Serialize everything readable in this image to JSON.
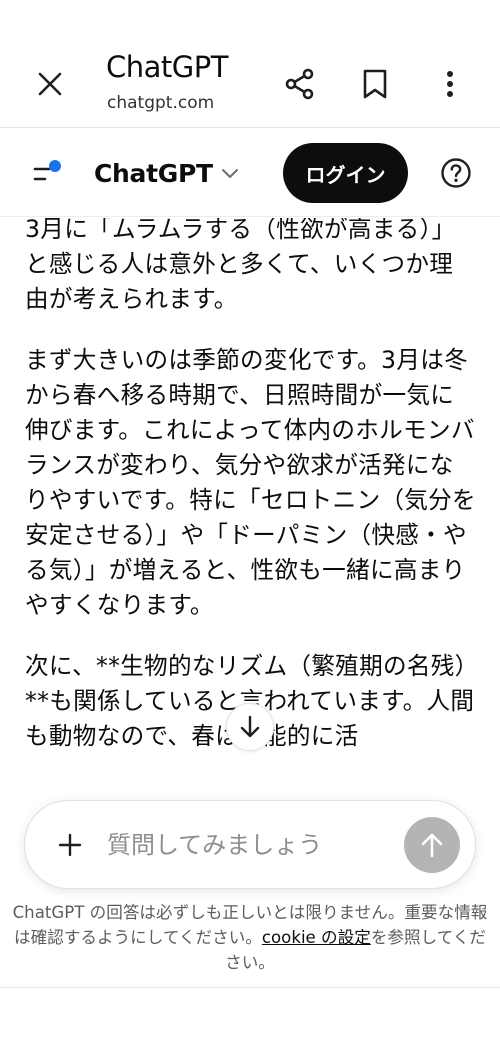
{
  "browser": {
    "title": "ChatGPT",
    "url": "chatgpt.com"
  },
  "header": {
    "model_name": "ChatGPT",
    "login_label": "ログイン"
  },
  "message": {
    "paragraphs": [
      "3月に「ムラムラする（性欲が高まる）」と感じる人は意外と多くて、いくつか理由が考えられます。",
      "まず大きいのは季節の変化です。3月は冬から春へ移る時期で、日照時間が一気に伸びます。これによって体内のホルモンバランスが変わり、気分や欲求が活発になりやすいです。特に「セロトニン（気分を安定させる）」や「ドーパミン（快感・やる気）」が増えると、性欲も一緒に高まりやすくなります。",
      "次に、**生物的なリズム（繁殖期の名残）**も関係していると言われています。人間も動物なので、春は本能的に活"
    ]
  },
  "composer": {
    "placeholder": "質問してみましょう"
  },
  "disclaimer": {
    "text_before": "ChatGPT の回答は必ずしも正しいとは限りません。重要な情報は確認するようにしてください。",
    "cookie_link": "cookie の設定",
    "text_after": "を参照してください。"
  },
  "colors": {
    "login_bg": "#0d0d0d",
    "send_disabled": "#b4b4b4",
    "sidebar_dot": "#1a73e8"
  },
  "icons": {
    "close": "close-icon",
    "share": "share-icon",
    "bookmark": "bookmark-icon",
    "menu": "more-vertical-icon",
    "sidebar": "sidebar-toggle-icon",
    "chevron": "chevron-down-icon",
    "help": "help-icon",
    "scroll": "arrow-down-icon",
    "attach": "plus-icon",
    "send": "arrow-up-icon"
  }
}
